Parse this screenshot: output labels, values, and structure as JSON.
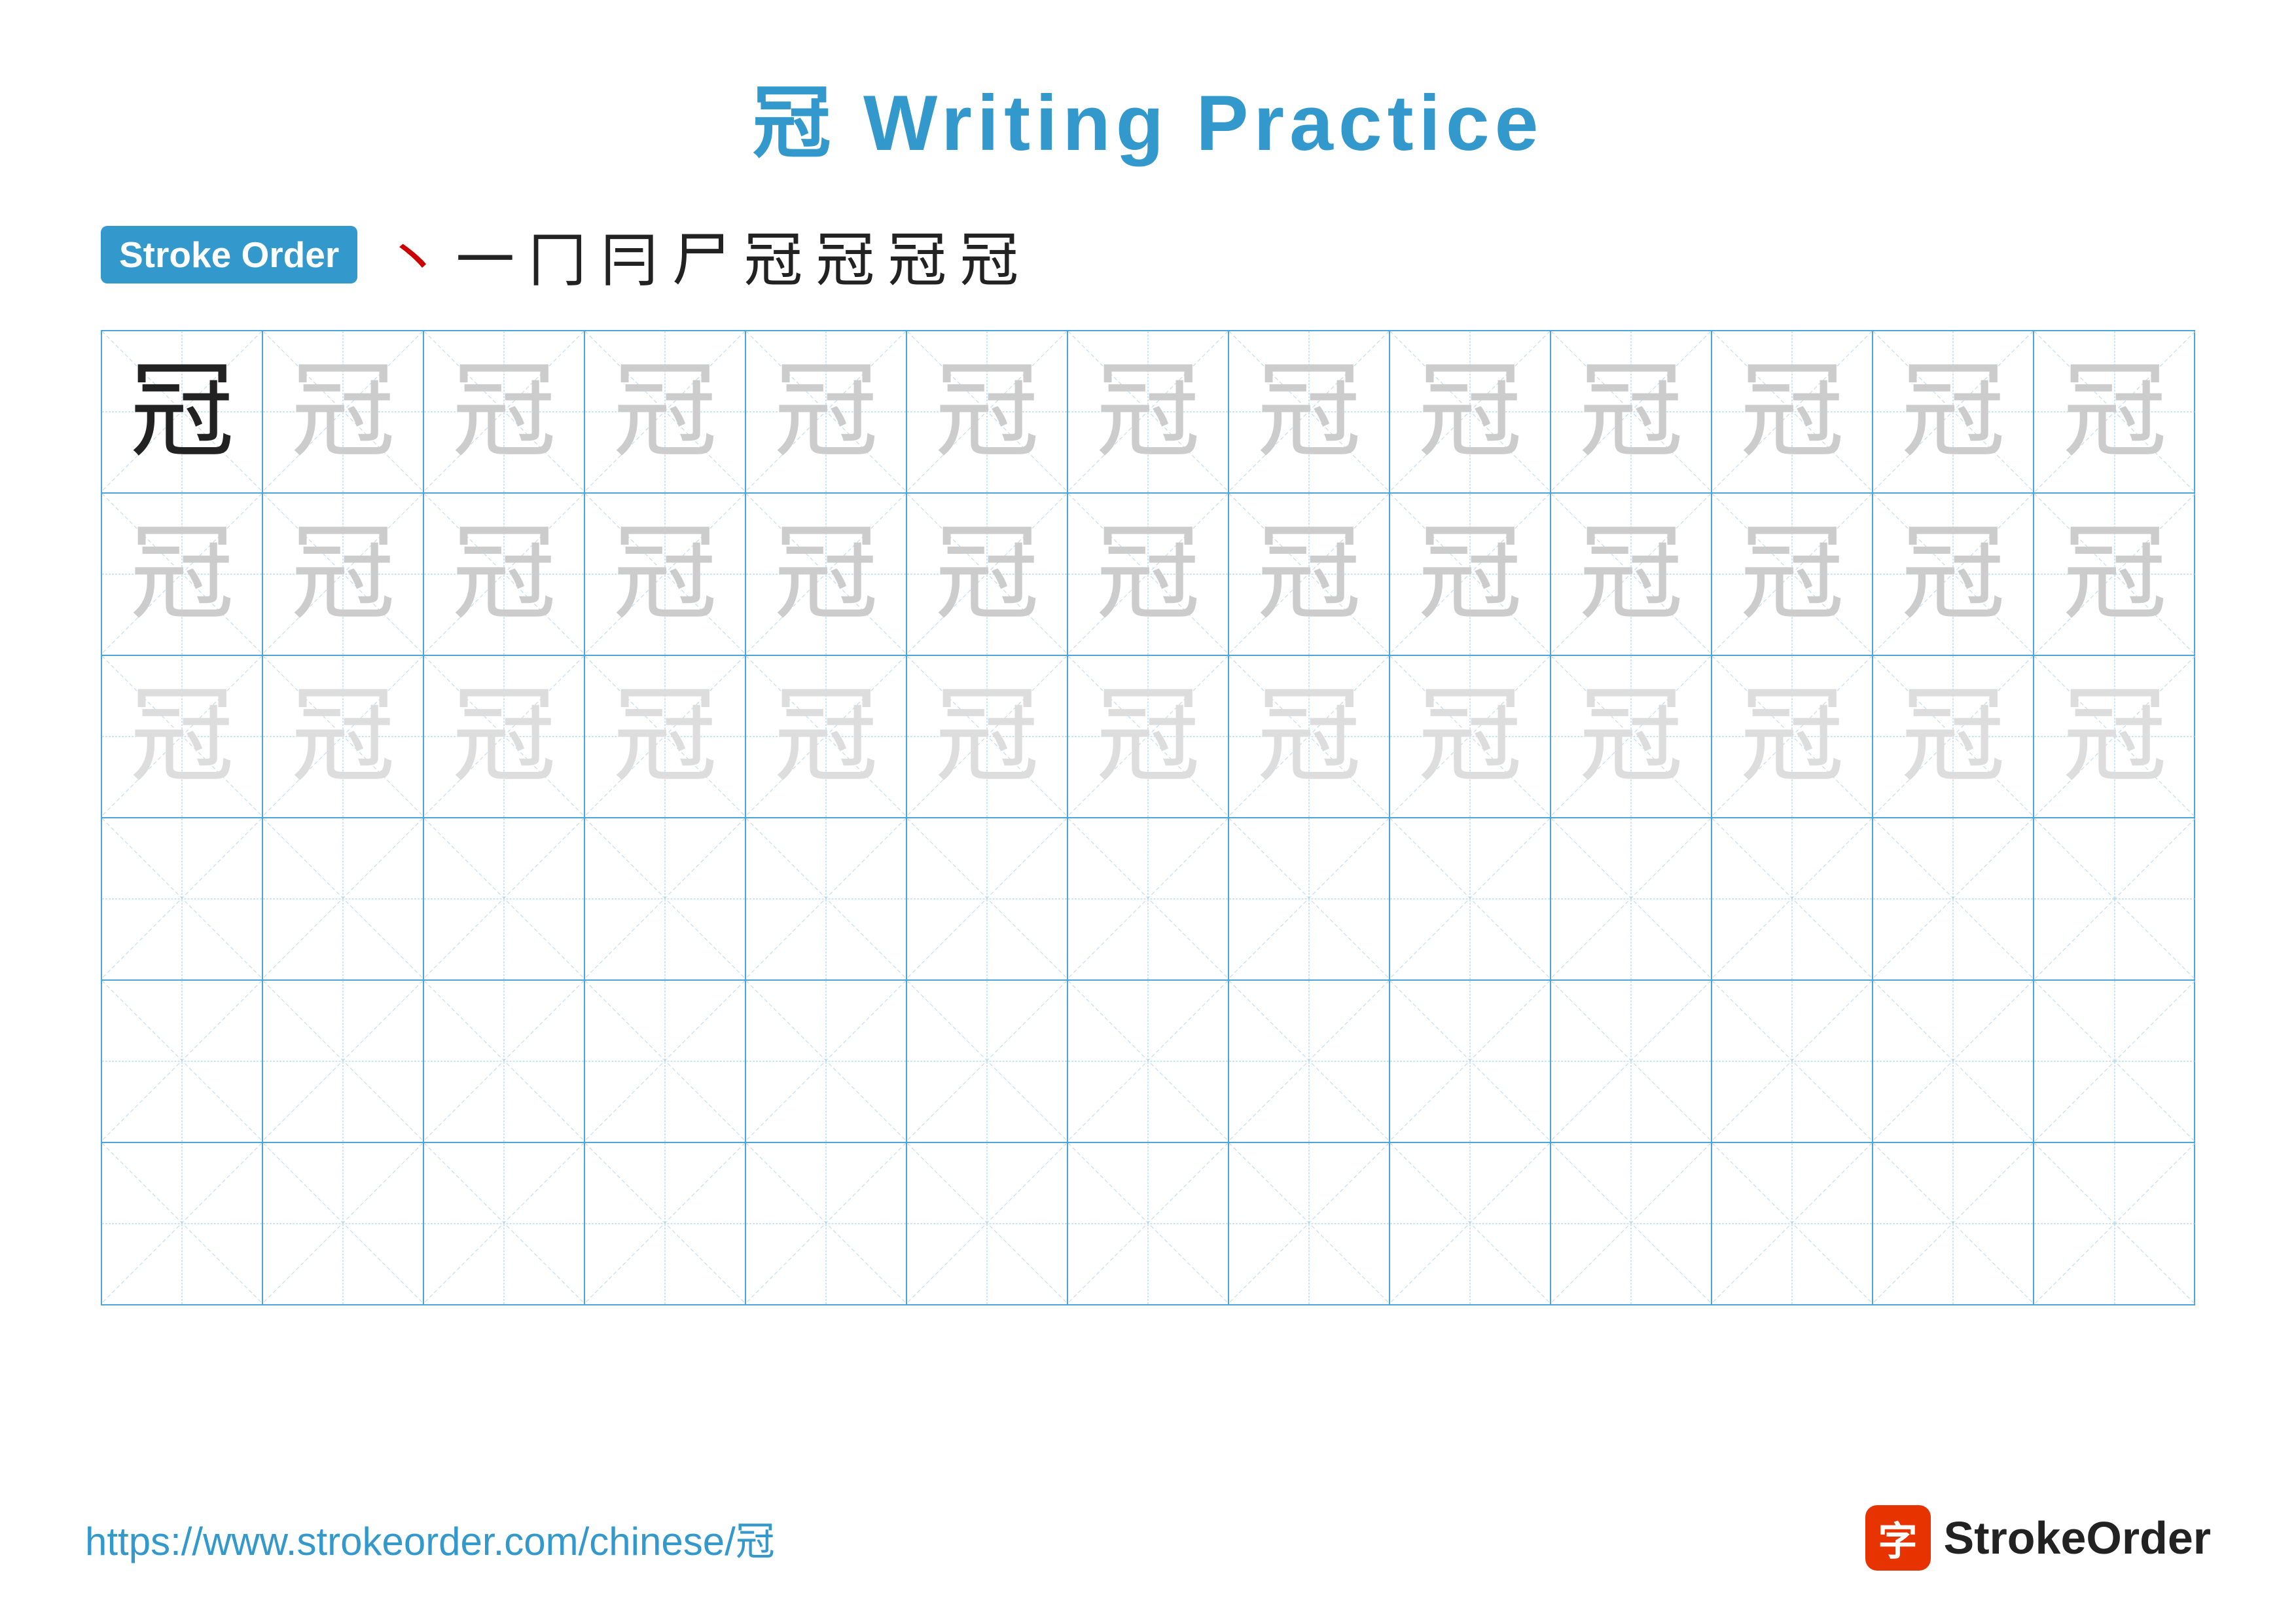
{
  "title": {
    "chinese_char": "冠",
    "english_text": " Writing Practice"
  },
  "stroke_order": {
    "badge_label": "Stroke Order",
    "strokes": [
      "丶",
      "一",
      "冂",
      "冃",
      "尸",
      "冠",
      "冠",
      "冠",
      "冠"
    ]
  },
  "grid": {
    "rows": 6,
    "cols": 13,
    "character": "冠",
    "row_types": [
      "dark-then-light",
      "light",
      "very-light",
      "empty",
      "empty",
      "empty"
    ]
  },
  "footer": {
    "url": "https://www.strokeorder.com/chinese/冠",
    "brand_name": "StrokeOrder",
    "logo_char": "字"
  }
}
